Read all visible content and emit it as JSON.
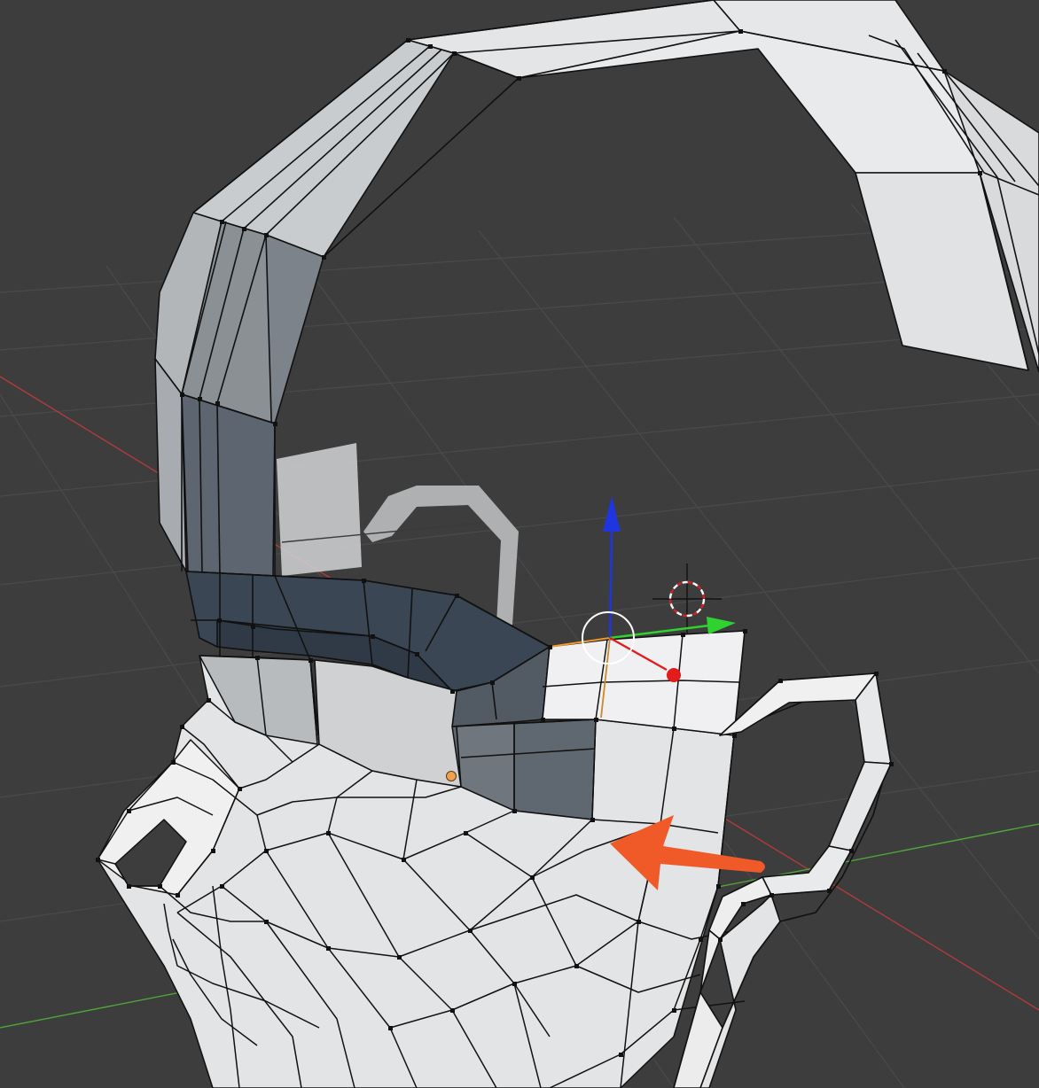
{
  "viewport": {
    "mode": "edit-mode",
    "background": "#3d3d3d",
    "colors": {
      "grid": "#4a4a4a",
      "axis_x": "#b03b3b",
      "axis_y": "#4fa63a",
      "gizmo_x": "#e21b1b",
      "gizmo_y": "#2fd22f",
      "gizmo_z": "#1f35e0",
      "selection": "#f29b2a",
      "annotation_arrow": "#f05a28",
      "wire": "#111111",
      "mesh_light": "#e7e8ea",
      "mesh_shadow": "#2c3843"
    },
    "icons": [
      "transform-gizmo-icon",
      "3d-cursor-icon",
      "object-origin-icon",
      "annotation-arrow-icon"
    ]
  }
}
